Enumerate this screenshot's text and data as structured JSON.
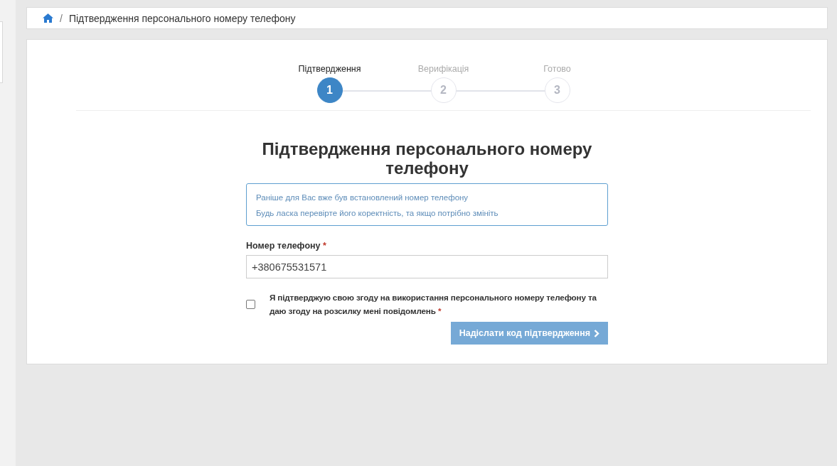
{
  "breadcrumb": {
    "separator": "/",
    "current": "Підтвердження персонального номеру телефону"
  },
  "steps": [
    {
      "label": "Підтвердження",
      "number": "1",
      "selected": true
    },
    {
      "label": "Верифікація",
      "number": "2",
      "selected": false
    },
    {
      "label": "Готово",
      "number": "3",
      "selected": false
    }
  ],
  "title": "Підтвердження персонального номеру телефону",
  "notice": [
    "Раніше для Вас вже був встановлений номер телефону",
    "Будь ласка перевірте його коректність, та якщо потрібно змініть"
  ],
  "phone": {
    "label": "Номер телефону",
    "required_mark": "*",
    "value": "+380675531571"
  },
  "consent": {
    "text": "Я підтверджую свою згоду на використання персонального номеру телефону та даю згоду на розсилку мені повідомлень",
    "required_mark": "*",
    "checked": false
  },
  "submit": {
    "label": "Надіслати код підтвердження",
    "disabled": true
  }
}
